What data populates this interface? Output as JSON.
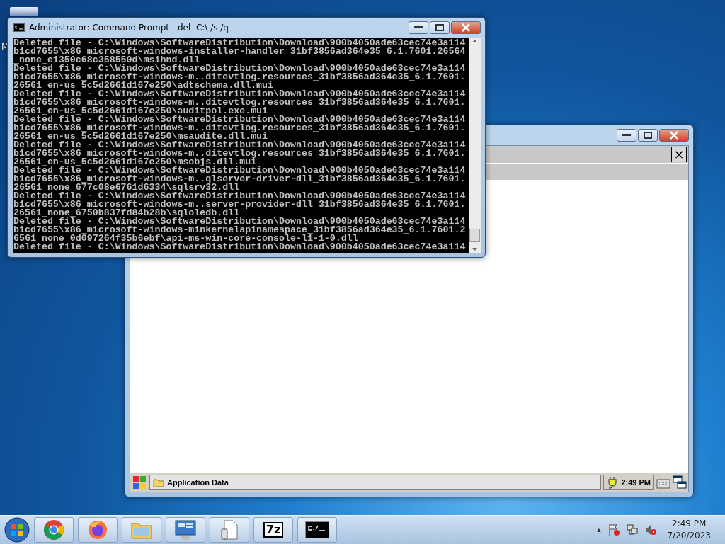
{
  "desktop_icons": [
    {
      "label": "M"
    }
  ],
  "console_window": {
    "title": "Administrator: Command Prompt - del  C:\\ /s /q",
    "lines": [
      "Deleted file - C:\\Windows\\SoftwareDistribution\\Download\\900b4050ade63cec74e3a114",
      "b1cd7655\\x86_microsoft-windows-installer-handler_31bf3856ad364e35_6.1.7601.26564",
      "_none_e1350c68c358550d\\msihnd.dll",
      "Deleted file - C:\\Windows\\SoftwareDistribution\\Download\\900b4050ade63cec74e3a114",
      "b1cd7655\\x86_microsoft-windows-m..ditevtlog.resources_31bf3856ad364e35_6.1.7601.",
      "26561_en-us_5c5d2661d167e250\\adtschema.dll.mui",
      "Deleted file - C:\\Windows\\SoftwareDistribution\\Download\\900b4050ade63cec74e3a114",
      "b1cd7655\\x86_microsoft-windows-m..ditevtlog.resources_31bf3856ad364e35_6.1.7601.",
      "26561_en-us_5c5d2661d167e250\\auditpol.exe.mui",
      "Deleted file - C:\\Windows\\SoftwareDistribution\\Download\\900b4050ade63cec74e3a114",
      "b1cd7655\\x86_microsoft-windows-m..ditevtlog.resources_31bf3856ad364e35_6.1.7601.",
      "26561_en-us_5c5d2661d167e250\\msaudite.dll.mui",
      "Deleted file - C:\\Windows\\SoftwareDistribution\\Download\\900b4050ade63cec74e3a114",
      "b1cd7655\\x86_microsoft-windows-m..ditevtlog.resources_31bf3856ad364e35_6.1.7601.",
      "26561_en-us_5c5d2661d167e250\\msobjs.dll.mui",
      "Deleted file - C:\\Windows\\SoftwareDistribution\\Download\\900b4050ade63cec74e3a114",
      "b1cd7655\\x86_microsoft-windows-m..qlserver-driver-dll_31bf3856ad364e35_6.1.7601.",
      "26561_none_677c08e6761d6334\\sqlsrv32.dll",
      "Deleted file - C:\\Windows\\SoftwareDistribution\\Download\\900b4050ade63cec74e3a114",
      "b1cd7655\\x86_microsoft-windows-m..server-provider-dll_31bf3856ad364e35_6.1.7601.",
      "26561_none_6750b837fd84b28b\\sqloledb.dll",
      "Deleted file - C:\\Windows\\SoftwareDistribution\\Download\\900b4050ade63cec74e3a114",
      "b1cd7655\\x86_microsoft-windows-minkernelapinamespace_31bf3856ad364e35_6.1.7601.2",
      "6561_none_0d097264f35b6ebf\\api-ms-win-core-console-l1-1-0.dll",
      "Deleted file - C:\\Windows\\SoftwareDistribution\\Download\\900b4050ade63cec74e3a114"
    ]
  },
  "emulator_window": {
    "close_label": "×",
    "taskbar": {
      "task": "Application Data",
      "time": "2:49 PM"
    }
  },
  "taskbar": {
    "apps": [
      {
        "kind": "chrome"
      },
      {
        "kind": "firefox"
      },
      {
        "kind": "explorer"
      },
      {
        "kind": "remote"
      },
      {
        "kind": "device"
      },
      {
        "kind": "sevenzip",
        "label": "7z"
      },
      {
        "kind": "console"
      }
    ],
    "tray_toggle": "▲",
    "time": "2:49 PM",
    "date": "7/20/2023"
  }
}
